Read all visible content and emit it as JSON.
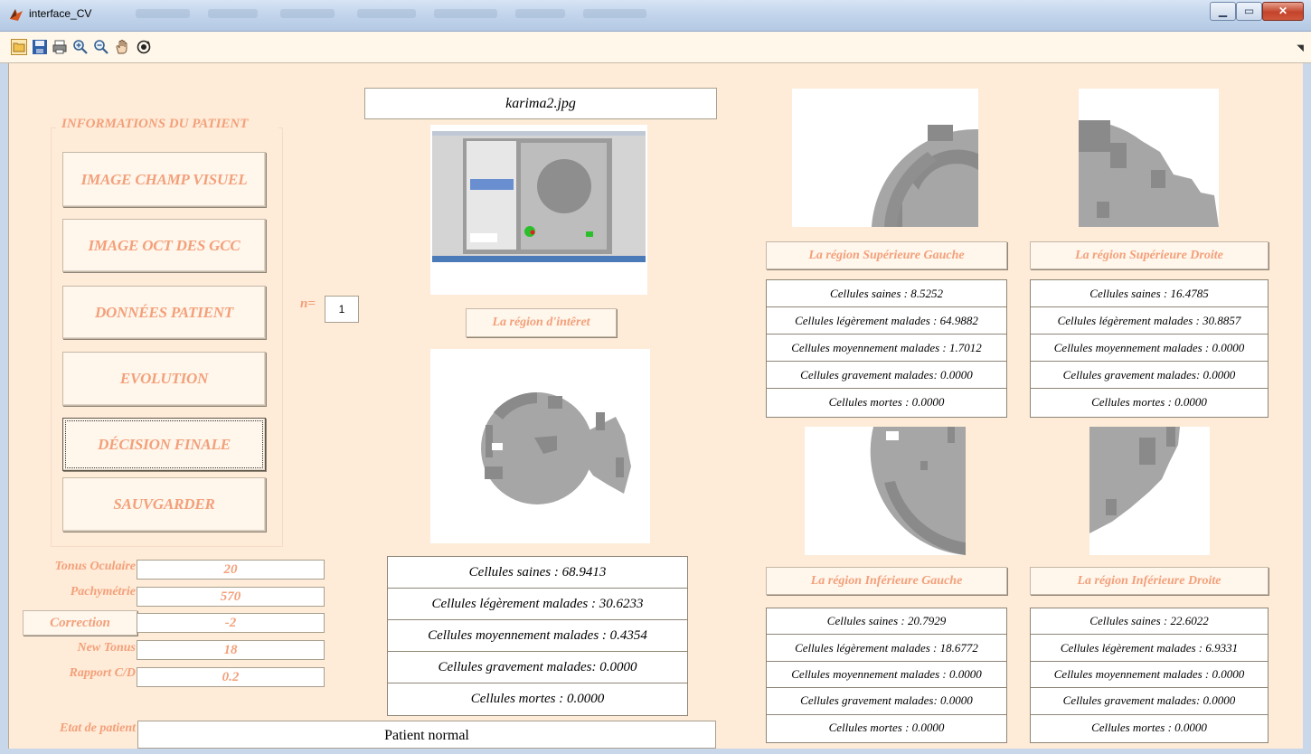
{
  "window": {
    "title": "interface_CV",
    "controls": [
      "minimize",
      "maximize",
      "close"
    ]
  },
  "toolbar": {
    "icons": [
      "open-folder-icon",
      "save-icon",
      "print-icon",
      "zoom-in-icon",
      "zoom-out-icon",
      "pan-hand-icon",
      "rotate-3d-icon"
    ]
  },
  "patient_panel": {
    "title": "INFORMATIONS DU PATIENT",
    "buttons": [
      "IMAGE CHAMP VISUEL",
      "IMAGE OCT DES GCC",
      "DONNÉES PATIENT",
      "EVOLUTION",
      "DÉCISION FINALE",
      "SAUVGARDER"
    ]
  },
  "n_field": {
    "label": "n=",
    "value": "1"
  },
  "image_filename": "karima2.jpg",
  "roi_button": "La région d'intêret",
  "roi_stats": [
    "Cellules saines : 68.9413",
    "Cellules légèrement malades : 30.6233",
    "Cellules moyennement malades : 0.4354",
    "Cellules gravement malades: 0.0000",
    "Cellules mortes : 0.0000"
  ],
  "measures": [
    {
      "label": "Tonus Oculaire",
      "value": "20"
    },
    {
      "label": "Pachymétrie",
      "value": "570"
    },
    {
      "label": "Correction",
      "value": "-2"
    },
    {
      "label": "New Tonus",
      "value": "18"
    },
    {
      "label": "Rapport C/D",
      "value": "0.2"
    }
  ],
  "etat": {
    "label": "Etat de patient",
    "value": "Patient normal"
  },
  "regions": {
    "sup_gauche": {
      "button": "La région Supérieure Gauche",
      "stats": [
        "Cellules saines : 8.5252",
        "Cellules légèrement malades : 64.9882",
        "Cellules moyennement malades : 1.7012",
        "Cellules gravement malades: 0.0000",
        "Cellules mortes : 0.0000"
      ]
    },
    "sup_droite": {
      "button": "La région Supérieure Droite",
      "stats": [
        "Cellules saines : 16.4785",
        "Cellules légèrement malades : 30.8857",
        "Cellules moyennement malades : 0.0000",
        "Cellules gravement malades: 0.0000",
        "Cellules mortes : 0.0000"
      ]
    },
    "inf_gauche": {
      "button": "La région Inférieure Gauche",
      "stats": [
        "Cellules saines : 20.7929",
        "Cellules légèrement malades : 18.6772",
        "Cellules moyennement malades : 0.0000",
        "Cellules gravement malades: 0.0000",
        "Cellules mortes : 0.0000"
      ]
    },
    "inf_droite": {
      "button": "La région Inférieure Droite",
      "stats": [
        "Cellules saines : 22.6022",
        "Cellules légèrement malades : 6.9331",
        "Cellules moyennement malades : 0.0000",
        "Cellules gravement malades: 0.0000",
        "Cellules mortes : 0.0000"
      ]
    }
  },
  "colors": {
    "accent_label": "#f3a07a",
    "background": "#feebd8",
    "gray_light": "#a6a6a6",
    "gray_dark": "#8a8a8a"
  }
}
